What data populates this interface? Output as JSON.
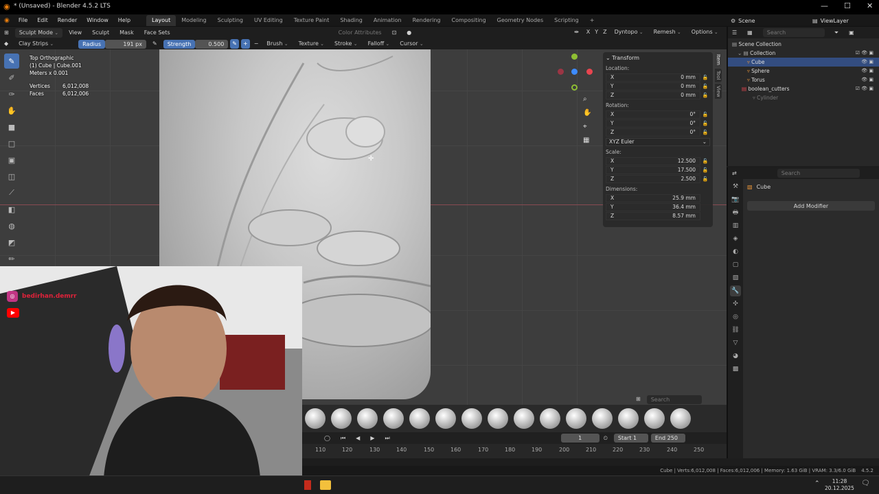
{
  "window": {
    "title": "* (Unsaved) - Blender 4.5.2 LTS"
  },
  "menu": {
    "items": [
      "File",
      "Edit",
      "Render",
      "Window",
      "Help"
    ]
  },
  "workspaces": [
    "Layout",
    "Modeling",
    "Sculpting",
    "UV Editing",
    "Texture Paint",
    "Shading",
    "Animation",
    "Rendering",
    "Compositing",
    "Geometry Nodes",
    "Scripting"
  ],
  "scene": {
    "label": "Scene",
    "view_layer": "ViewLayer"
  },
  "header1": {
    "mode": "Sculpt Mode",
    "items": [
      "View",
      "Sculpt",
      "Mask",
      "Face Sets"
    ],
    "color_attributes": "Color Attributes",
    "dyntopo": "Dyntopo",
    "remesh": "Remesh",
    "options": "Options",
    "axes": [
      "X",
      "Y",
      "Z"
    ]
  },
  "header2": {
    "brush_name": "Clay Strips",
    "radius_label": "Radius",
    "radius_value": "191 px",
    "strength_label": "Strength",
    "strength_value": "0.500",
    "menus": [
      "Brush",
      "Texture",
      "Stroke",
      "Falloff",
      "Cursor"
    ]
  },
  "viewport_info": {
    "view": "Top Orthographic",
    "object": "(1) Cube | Cube.001",
    "scale": "Meters x 0.001",
    "vertices_label": "Vertices",
    "vertices": "6,012,008",
    "faces_label": "Faces",
    "faces": "6,012,006"
  },
  "npanel": {
    "title": "Transform",
    "location_label": "Location:",
    "location": [
      {
        "axis": "X",
        "value": "0 mm"
      },
      {
        "axis": "Y",
        "value": "0 mm"
      },
      {
        "axis": "Z",
        "value": "0 mm"
      }
    ],
    "rotation_label": "Rotation:",
    "rotation": [
      {
        "axis": "X",
        "value": "0°"
      },
      {
        "axis": "Y",
        "value": "0°"
      },
      {
        "axis": "Z",
        "value": "0°"
      }
    ],
    "rotation_mode": "XYZ Euler",
    "scale_label": "Scale:",
    "scale": [
      {
        "axis": "X",
        "value": "12.500"
      },
      {
        "axis": "Y",
        "value": "17.500"
      },
      {
        "axis": "Z",
        "value": "2.500"
      }
    ],
    "dimensions_label": "Dimensions:",
    "dimensions": [
      {
        "axis": "X",
        "value": "25.9 mm"
      },
      {
        "axis": "Y",
        "value": "36.4 mm"
      },
      {
        "axis": "Z",
        "value": "8.57 mm"
      }
    ],
    "tabs": [
      "Item",
      "Tool",
      "View"
    ]
  },
  "outliner": {
    "search_placeholder": "Search",
    "rows": [
      "Scene Collection",
      "Collection",
      "Cube",
      "Sphere",
      "Torus",
      "boolean_cutters",
      "Cylinder"
    ]
  },
  "properties": {
    "search_placeholder": "Search",
    "object_name": "Cube",
    "add_modifier": "Add Modifier"
  },
  "webcam": {
    "instagram": "bedirhan.demrr"
  },
  "shelf_search": "Search",
  "timeline": {
    "current_frame": "1",
    "start_label": "Start",
    "start": "1",
    "end_label": "End",
    "end": "250",
    "ticks": [
      "110",
      "120",
      "130",
      "140",
      "150",
      "160",
      "170",
      "180",
      "190",
      "200",
      "210",
      "220",
      "230",
      "240",
      "250"
    ]
  },
  "statusbar": {
    "text": "Cube | Verts:6,012,008 | Faces:6,012,006 | Memory: 1.63 GiB | VRAM: 3.3/6.0 GiB",
    "version": "4.5.2"
  },
  "taskbar": {
    "time": "11:28",
    "date": "20.12.2025"
  }
}
